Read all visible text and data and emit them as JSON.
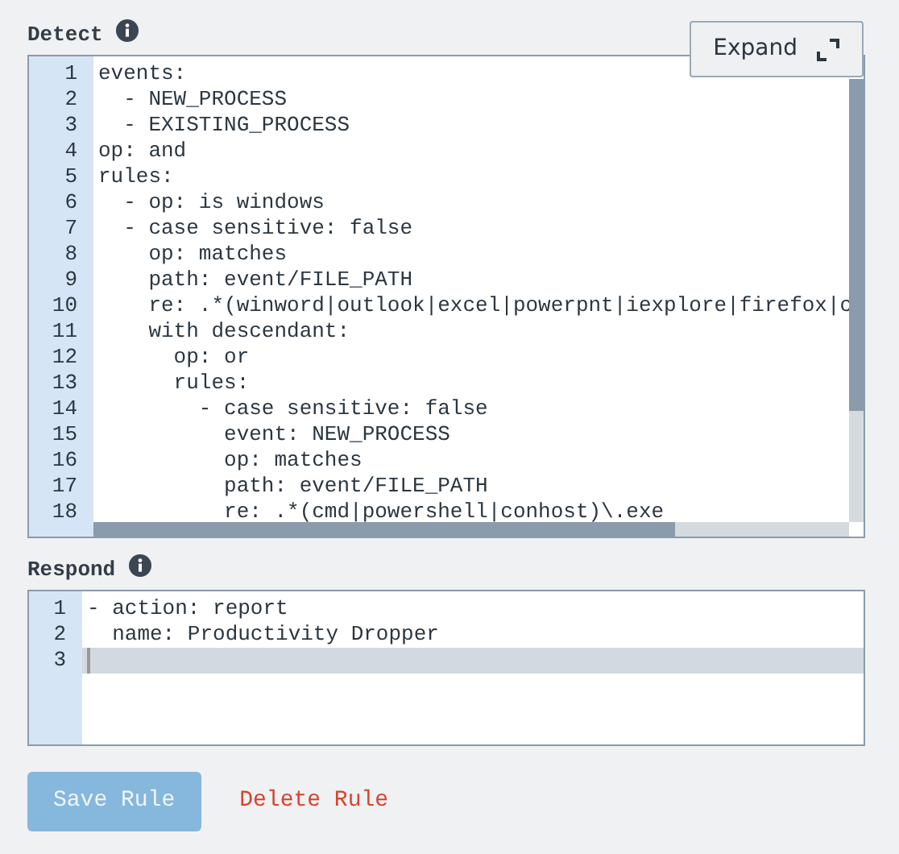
{
  "detect": {
    "label": "Detect",
    "expand_button": "Expand",
    "lines": [
      {
        "number": "1",
        "text": "events:"
      },
      {
        "number": "2",
        "text": "  - NEW_PROCESS"
      },
      {
        "number": "3",
        "text": "  - EXISTING_PROCESS"
      },
      {
        "number": "4",
        "text": "op: and"
      },
      {
        "number": "5",
        "text": "rules:"
      },
      {
        "number": "6",
        "text": "  - op: is windows"
      },
      {
        "number": "7",
        "text": "  - case sensitive: false"
      },
      {
        "number": "8",
        "text": "    op: matches"
      },
      {
        "number": "9",
        "text": "    path: event/FILE_PATH"
      },
      {
        "number": "10",
        "text": "    re: .*(winword|outlook|excel|powerpnt|iexplore|firefox|c"
      },
      {
        "number": "11",
        "text": "    with descendant:"
      },
      {
        "number": "12",
        "text": "      op: or"
      },
      {
        "number": "13",
        "text": "      rules:"
      },
      {
        "number": "14",
        "text": "        - case sensitive: false"
      },
      {
        "number": "15",
        "text": "          event: NEW_PROCESS"
      },
      {
        "number": "16",
        "text": "          op: matches"
      },
      {
        "number": "17",
        "text": "          path: event/FILE_PATH"
      },
      {
        "number": "18",
        "text": "          re: .*(cmd|powershell|conhost)\\.exe"
      }
    ]
  },
  "respond": {
    "label": "Respond",
    "lines": [
      {
        "number": "1",
        "text": "- action: report",
        "active": false
      },
      {
        "number": "2",
        "text": "  name: Productivity Dropper",
        "active": false
      },
      {
        "number": "3",
        "active": true
      }
    ]
  },
  "buttons": [
    {
      "label": "Save Rule",
      "kind": "primary",
      "disabled": true
    },
    {
      "label": "Delete Rule",
      "kind": "danger",
      "disabled": false
    }
  ]
}
